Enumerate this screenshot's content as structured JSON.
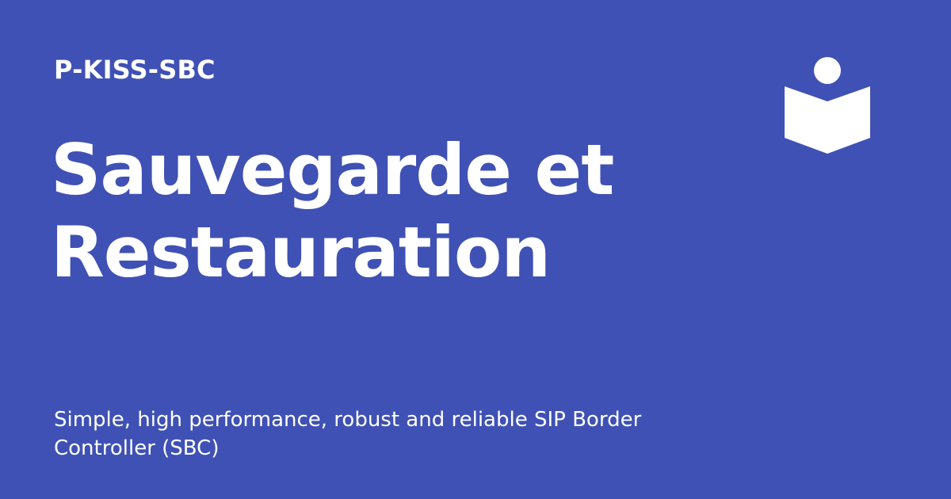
{
  "site": {
    "name": "P-KISS-SBC"
  },
  "page": {
    "title_line1": "Sauvegarde et",
    "title_line2": "Restauration",
    "description": "Simple, high performance, robust and reliable SIP Border Controller (SBC)"
  },
  "logo": {
    "icon": "reader-book-icon"
  },
  "colors": {
    "background": "#3F51B5",
    "foreground": "#FFFFFF"
  }
}
